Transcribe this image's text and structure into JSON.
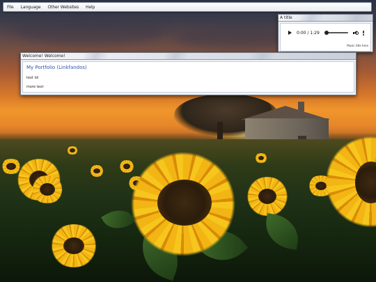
{
  "menubar": {
    "items": [
      {
        "label": "File"
      },
      {
        "label": "Language"
      },
      {
        "label": "Other Websites"
      },
      {
        "label": "Help"
      }
    ]
  },
  "audio_window": {
    "title": "A title",
    "player": {
      "time": "0:00 / 1:29",
      "play_icon": "play-icon",
      "volume_icon": "volume-icon",
      "menu_icon": "more-options-icon",
      "progress": 0
    },
    "caption": "Music title here"
  },
  "welcome_window": {
    "title": "Welcome! Welcome!",
    "link": "My Portfolio (Linkfandos)",
    "lines": [
      "text lol",
      "more text"
    ],
    "colors": {
      "link": "#2f56a8"
    }
  },
  "wallpaper": {
    "scene": "sunflower-field-sunset"
  }
}
